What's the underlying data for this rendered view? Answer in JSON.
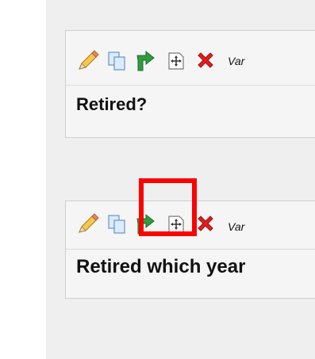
{
  "fields": [
    {
      "title": "Retired?",
      "variable_label": "Var"
    },
    {
      "title": "Retired which year",
      "variable_label": "Var"
    }
  ],
  "icons": {
    "edit": "pencil-icon",
    "copy": "copy-icon",
    "branch": "branch-logic-icon",
    "move": "move-icon",
    "delete": "delete-icon"
  },
  "colors": {
    "highlight": "#ff0000",
    "branch_icon": "#2f9b3e",
    "delete_icon": "#e21d1d"
  }
}
